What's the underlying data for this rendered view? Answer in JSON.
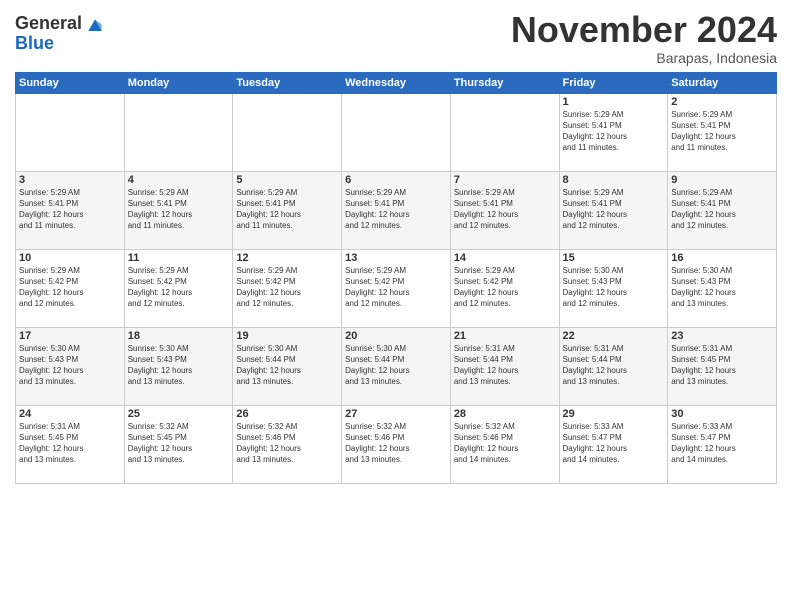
{
  "logo": {
    "general": "General",
    "blue": "Blue"
  },
  "header": {
    "title": "November 2024",
    "subtitle": "Barapas, Indonesia"
  },
  "days_of_week": [
    "Sunday",
    "Monday",
    "Tuesday",
    "Wednesday",
    "Thursday",
    "Friday",
    "Saturday"
  ],
  "weeks": [
    [
      {
        "day": "",
        "info": ""
      },
      {
        "day": "",
        "info": ""
      },
      {
        "day": "",
        "info": ""
      },
      {
        "day": "",
        "info": ""
      },
      {
        "day": "",
        "info": ""
      },
      {
        "day": "1",
        "info": "Sunrise: 5:29 AM\nSunset: 5:41 PM\nDaylight: 12 hours\nand 11 minutes."
      },
      {
        "day": "2",
        "info": "Sunrise: 5:29 AM\nSunset: 5:41 PM\nDaylight: 12 hours\nand 11 minutes."
      }
    ],
    [
      {
        "day": "3",
        "info": "Sunrise: 5:29 AM\nSunset: 5:41 PM\nDaylight: 12 hours\nand 11 minutes."
      },
      {
        "day": "4",
        "info": "Sunrise: 5:29 AM\nSunset: 5:41 PM\nDaylight: 12 hours\nand 11 minutes."
      },
      {
        "day": "5",
        "info": "Sunrise: 5:29 AM\nSunset: 5:41 PM\nDaylight: 12 hours\nand 11 minutes."
      },
      {
        "day": "6",
        "info": "Sunrise: 5:29 AM\nSunset: 5:41 PM\nDaylight: 12 hours\nand 12 minutes."
      },
      {
        "day": "7",
        "info": "Sunrise: 5:29 AM\nSunset: 5:41 PM\nDaylight: 12 hours\nand 12 minutes."
      },
      {
        "day": "8",
        "info": "Sunrise: 5:29 AM\nSunset: 5:41 PM\nDaylight: 12 hours\nand 12 minutes."
      },
      {
        "day": "9",
        "info": "Sunrise: 5:29 AM\nSunset: 5:41 PM\nDaylight: 12 hours\nand 12 minutes."
      }
    ],
    [
      {
        "day": "10",
        "info": "Sunrise: 5:29 AM\nSunset: 5:42 PM\nDaylight: 12 hours\nand 12 minutes."
      },
      {
        "day": "11",
        "info": "Sunrise: 5:29 AM\nSunset: 5:42 PM\nDaylight: 12 hours\nand 12 minutes."
      },
      {
        "day": "12",
        "info": "Sunrise: 5:29 AM\nSunset: 5:42 PM\nDaylight: 12 hours\nand 12 minutes."
      },
      {
        "day": "13",
        "info": "Sunrise: 5:29 AM\nSunset: 5:42 PM\nDaylight: 12 hours\nand 12 minutes."
      },
      {
        "day": "14",
        "info": "Sunrise: 5:29 AM\nSunset: 5:42 PM\nDaylight: 12 hours\nand 12 minutes."
      },
      {
        "day": "15",
        "info": "Sunrise: 5:30 AM\nSunset: 5:43 PM\nDaylight: 12 hours\nand 12 minutes."
      },
      {
        "day": "16",
        "info": "Sunrise: 5:30 AM\nSunset: 5:43 PM\nDaylight: 12 hours\nand 13 minutes."
      }
    ],
    [
      {
        "day": "17",
        "info": "Sunrise: 5:30 AM\nSunset: 5:43 PM\nDaylight: 12 hours\nand 13 minutes."
      },
      {
        "day": "18",
        "info": "Sunrise: 5:30 AM\nSunset: 5:43 PM\nDaylight: 12 hours\nand 13 minutes."
      },
      {
        "day": "19",
        "info": "Sunrise: 5:30 AM\nSunset: 5:44 PM\nDaylight: 12 hours\nand 13 minutes."
      },
      {
        "day": "20",
        "info": "Sunrise: 5:30 AM\nSunset: 5:44 PM\nDaylight: 12 hours\nand 13 minutes."
      },
      {
        "day": "21",
        "info": "Sunrise: 5:31 AM\nSunset: 5:44 PM\nDaylight: 12 hours\nand 13 minutes."
      },
      {
        "day": "22",
        "info": "Sunrise: 5:31 AM\nSunset: 5:44 PM\nDaylight: 12 hours\nand 13 minutes."
      },
      {
        "day": "23",
        "info": "Sunrise: 5:31 AM\nSunset: 5:45 PM\nDaylight: 12 hours\nand 13 minutes."
      }
    ],
    [
      {
        "day": "24",
        "info": "Sunrise: 5:31 AM\nSunset: 5:45 PM\nDaylight: 12 hours\nand 13 minutes."
      },
      {
        "day": "25",
        "info": "Sunrise: 5:32 AM\nSunset: 5:45 PM\nDaylight: 12 hours\nand 13 minutes."
      },
      {
        "day": "26",
        "info": "Sunrise: 5:32 AM\nSunset: 5:46 PM\nDaylight: 12 hours\nand 13 minutes."
      },
      {
        "day": "27",
        "info": "Sunrise: 5:32 AM\nSunset: 5:46 PM\nDaylight: 12 hours\nand 13 minutes."
      },
      {
        "day": "28",
        "info": "Sunrise: 5:32 AM\nSunset: 5:46 PM\nDaylight: 12 hours\nand 14 minutes."
      },
      {
        "day": "29",
        "info": "Sunrise: 5:33 AM\nSunset: 5:47 PM\nDaylight: 12 hours\nand 14 minutes."
      },
      {
        "day": "30",
        "info": "Sunrise: 5:33 AM\nSunset: 5:47 PM\nDaylight: 12 hours\nand 14 minutes."
      }
    ]
  ]
}
